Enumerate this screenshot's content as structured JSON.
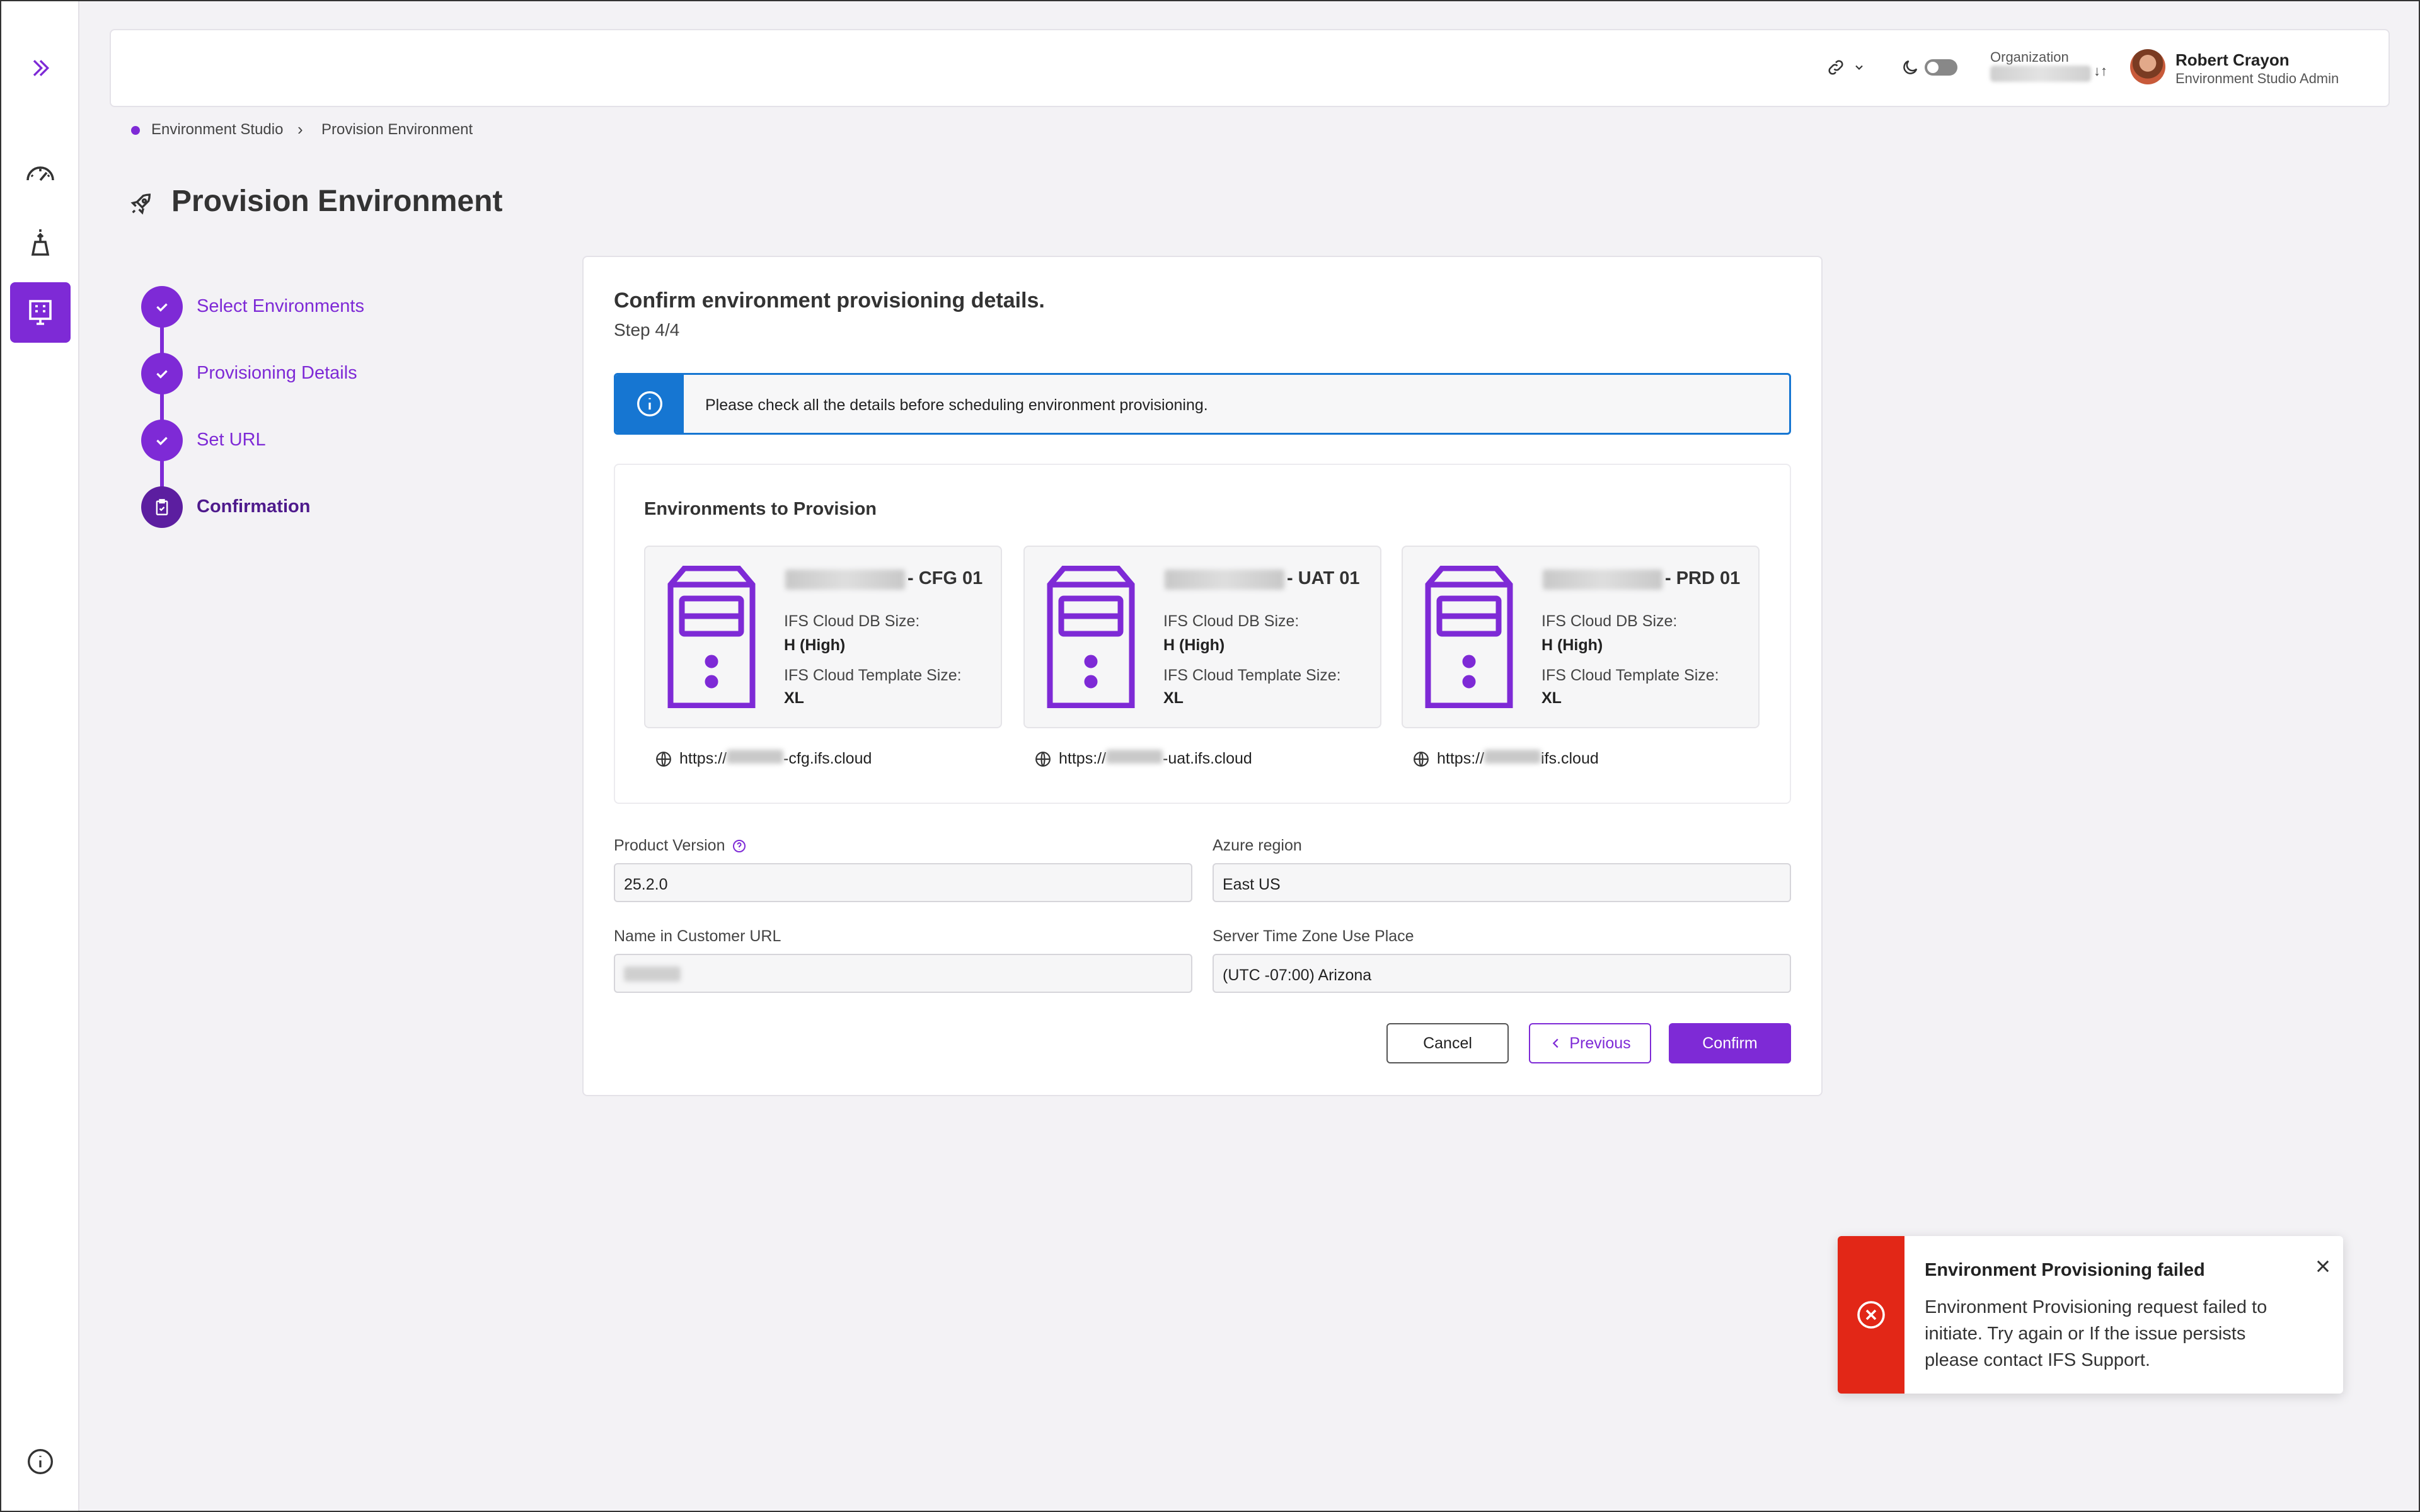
{
  "colors": {
    "accent": "#7e2ad6",
    "info": "#1676d2",
    "error": "#e22717"
  },
  "header": {
    "org_label": "Organization",
    "user_name": "Robert Crayon",
    "user_role": "Environment Studio Admin"
  },
  "breadcrumb": {
    "root": "Environment Studio",
    "current": "Provision Environment"
  },
  "page": {
    "title": "Provision Environment"
  },
  "steps": [
    {
      "label": "Select Environments",
      "state": "done"
    },
    {
      "label": "Provisioning Details",
      "state": "done"
    },
    {
      "label": "Set URL",
      "state": "done"
    },
    {
      "label": "Confirmation",
      "state": "current"
    }
  ],
  "card": {
    "title": "Confirm environment provisioning details.",
    "step": "Step 4/4",
    "info": "Please check all the details before scheduling environment provisioning."
  },
  "environments": {
    "heading": "Environments to Provision",
    "items": [
      {
        "suffix": "- CFG 01",
        "db_label": "IFS Cloud DB Size:",
        "db_value": "H (High)",
        "tpl_label": "IFS Cloud Template Size:",
        "tpl_value": "XL",
        "url_prefix": "https://",
        "url_suffix": "-cfg.ifs.cloud"
      },
      {
        "suffix": "- UAT 01",
        "db_label": "IFS Cloud DB Size:",
        "db_value": "H (High)",
        "tpl_label": "IFS Cloud Template Size:",
        "tpl_value": "XL",
        "url_prefix": "https://",
        "url_suffix": "-uat.ifs.cloud"
      },
      {
        "suffix": "- PRD 01",
        "db_label": "IFS Cloud DB Size:",
        "db_value": "H (High)",
        "tpl_label": "IFS Cloud Template Size:",
        "tpl_value": "XL",
        "url_prefix": "https://",
        "url_suffix": "ifs.cloud"
      }
    ]
  },
  "fields": {
    "product_version": {
      "label": "Product Version",
      "value": "25.2.0"
    },
    "azure_region": {
      "label": "Azure region",
      "value": "East US"
    },
    "customer_url": {
      "label": "Name in Customer URL"
    },
    "timezone": {
      "label": "Server Time Zone Use Place",
      "value": "(UTC -07:00) Arizona"
    }
  },
  "buttons": {
    "cancel": "Cancel",
    "previous": "Previous",
    "confirm": "Confirm"
  },
  "toast": {
    "title": "Environment Provisioning failed",
    "body": "Environment Provisioning request failed to initiate. Try again or If the issue persists please contact IFS Support."
  }
}
